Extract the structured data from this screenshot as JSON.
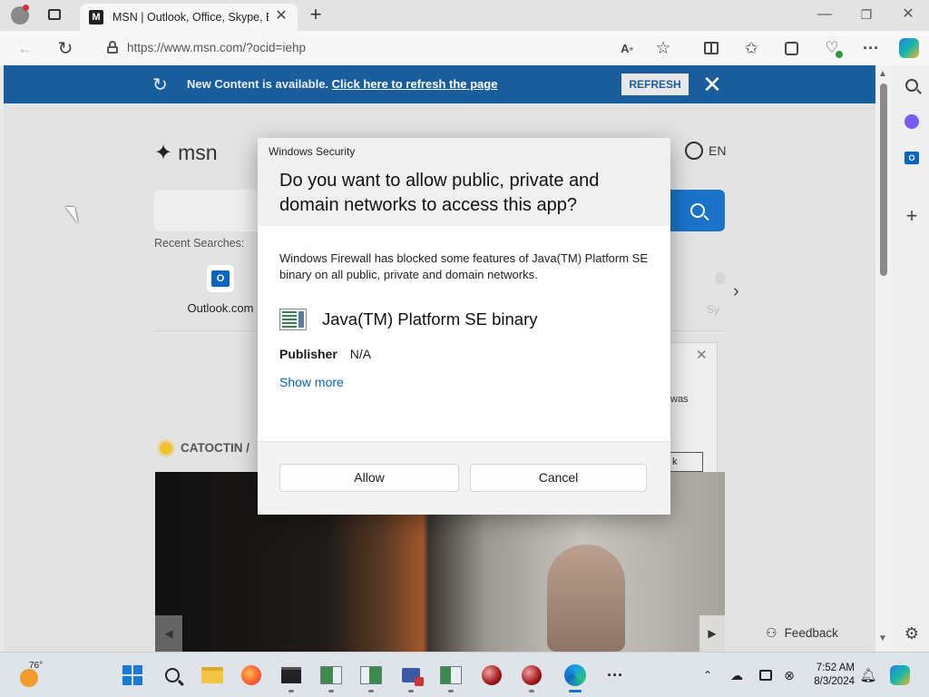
{
  "browser": {
    "tab_title": "MSN | Outlook, Office, Skype, Bi",
    "url": "https://www.msn.com/?ocid=iehp"
  },
  "banner": {
    "message": "New Content is available.",
    "link": "Click here to refresh the page",
    "refresh_button": "REFRESH"
  },
  "msn": {
    "logo": "msn",
    "language": "EN",
    "recent_label": "Recent Searches:",
    "outlook_label": "Outlook.com",
    "partial_label": "Sy",
    "weather_partial": "CATOCTIN /",
    "feedback": "Feedback",
    "bg_dialog_partial_text": "was",
    "bg_dialog_partial_button": "k"
  },
  "dialog": {
    "window_title": "Windows Security",
    "heading": "Do you want to allow public, private and domain networks to access this app?",
    "message": "Windows Firewall has blocked some features of Java(TM) Platform SE binary on all public, private and domain networks.",
    "app_name": "Java(TM) Platform SE binary",
    "publisher_label": "Publisher",
    "publisher_value": "N/A",
    "show_more": "Show more",
    "allow_button": "Allow",
    "cancel_button": "Cancel"
  },
  "taskbar": {
    "weather_temp": "76°",
    "time": "7:52 AM",
    "date": "8/3/2024"
  },
  "colors": {
    "banner": "#1a5d9c",
    "search_button": "#1a73c8",
    "dialog_link": "#0067c0"
  }
}
